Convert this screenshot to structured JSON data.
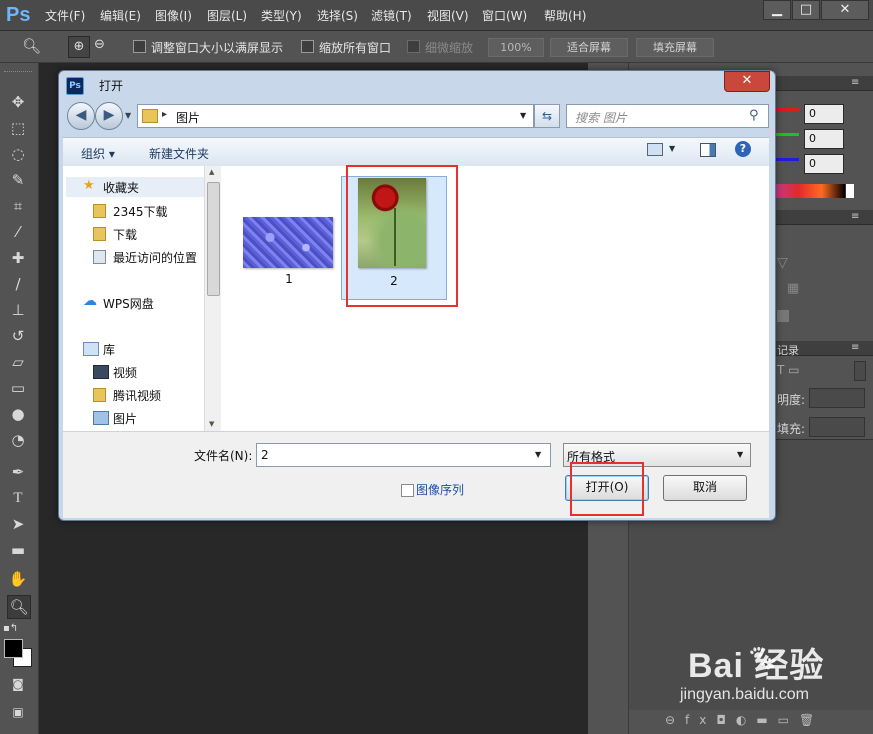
{
  "app": {
    "logo": "Ps",
    "menus": [
      "文件(F)",
      "编辑(E)",
      "图像(I)",
      "图层(L)",
      "类型(Y)",
      "选择(S)",
      "滤镜(T)",
      "视图(V)",
      "窗口(W)",
      "帮助(H)"
    ],
    "window_controls": {
      "minimize": "▁",
      "maximize": "□",
      "close": "✕"
    }
  },
  "options_bar": {
    "resize_windows": "调整窗口大小以满屏显示",
    "zoom_all": "缩放所有窗口",
    "scrubby_zoom": "细微缩放",
    "zoom_level": "100%",
    "fit_screen": "适合屏幕",
    "fill_screen": "填充屏幕"
  },
  "tools": [
    "move-tool",
    "marquee-tool",
    "lasso-tool",
    "quick-selection-tool",
    "crop-tool",
    "eyedropper-tool",
    "healing-brush-tool",
    "brush-tool",
    "clone-stamp-tool",
    "history-brush-tool",
    "eraser-tool",
    "gradient-tool",
    "blur-tool",
    "dodge-tool",
    "pen-tool",
    "type-tool",
    "path-selection-tool",
    "shape-tool",
    "hand-tool",
    "zoom-tool"
  ],
  "right_panel": {
    "color_values": [
      "0",
      "0",
      "0"
    ],
    "history_label": "记录",
    "opacity_label": "明度:",
    "fill_label": "填充:"
  },
  "dialog": {
    "title": "打开",
    "icon": "Ps",
    "address": {
      "path": "图片",
      "separator": "▸"
    },
    "search_placeholder": "搜索 图片",
    "toolbar": {
      "organize": "组织 ▾",
      "new_folder": "新建文件夹"
    },
    "nav_pane": {
      "favorites_label": "收藏夹",
      "favorites": [
        "2345下载",
        "下载",
        "最近访问的位置"
      ],
      "wps": "WPS网盘",
      "library_label": "库",
      "library": [
        "视频",
        "腾讯视频",
        "图片"
      ]
    },
    "files": [
      {
        "name": "1"
      },
      {
        "name": "2"
      }
    ],
    "file_name_label": "文件名(N):",
    "file_name_value": "2",
    "file_type_value": "所有格式",
    "image_sequence_label": "图像序列",
    "open_button": "打开(O)",
    "cancel_button": "取消"
  },
  "watermark": {
    "brand": "Bai  经验",
    "url": "jingyan.baidu.com"
  },
  "colors": {
    "ps_dark": "#535353",
    "canvas": "#282828",
    "dialog_frame": "#c8d8ea",
    "highlight": "#e5322d",
    "selection": "#d6e8fb"
  }
}
